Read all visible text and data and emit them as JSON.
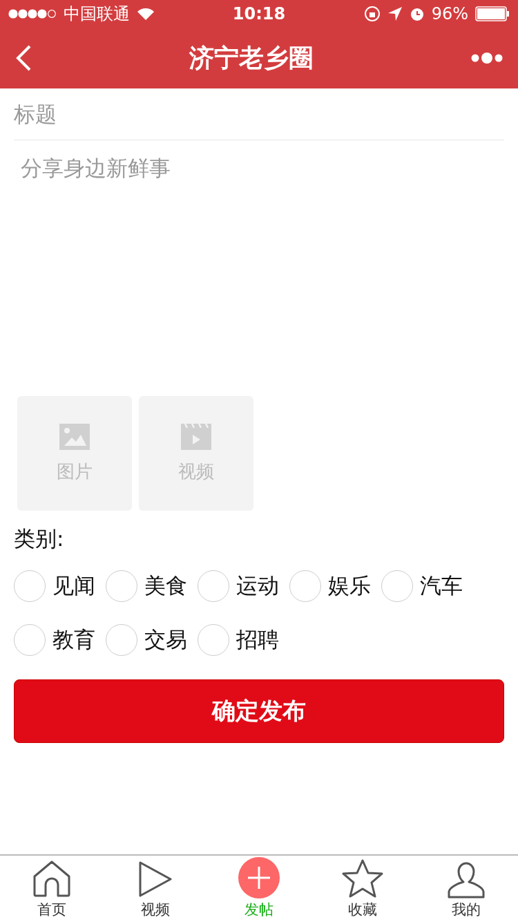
{
  "status_bar": {
    "carrier": "中国联通",
    "time": "10:18",
    "battery": "96%"
  },
  "nav": {
    "title": "济宁老乡圈"
  },
  "form": {
    "title_placeholder": "标题",
    "body_placeholder": "分享身边新鲜事",
    "uploads": [
      {
        "kind": "image",
        "label": "图片"
      },
      {
        "kind": "video",
        "label": "视频"
      }
    ],
    "category_label": "类别:",
    "categories": [
      {
        "label": "见闻",
        "checked": false
      },
      {
        "label": "美食",
        "checked": false
      },
      {
        "label": "运动",
        "checked": false
      },
      {
        "label": "娱乐",
        "checked": false
      },
      {
        "label": "汽车",
        "checked": false
      },
      {
        "label": "教育",
        "checked": false
      },
      {
        "label": "交易",
        "checked": false
      },
      {
        "label": "招聘",
        "checked": false
      }
    ],
    "submit": "确定发布"
  },
  "tab_bar": [
    {
      "kind": "home",
      "label": "首页",
      "selected": false
    },
    {
      "kind": "video",
      "label": "视频",
      "selected": false
    },
    {
      "kind": "post",
      "label": "发帖",
      "selected": true
    },
    {
      "kind": "star",
      "label": "收藏",
      "selected": false
    },
    {
      "kind": "profile",
      "label": "我的",
      "selected": false
    }
  ]
}
